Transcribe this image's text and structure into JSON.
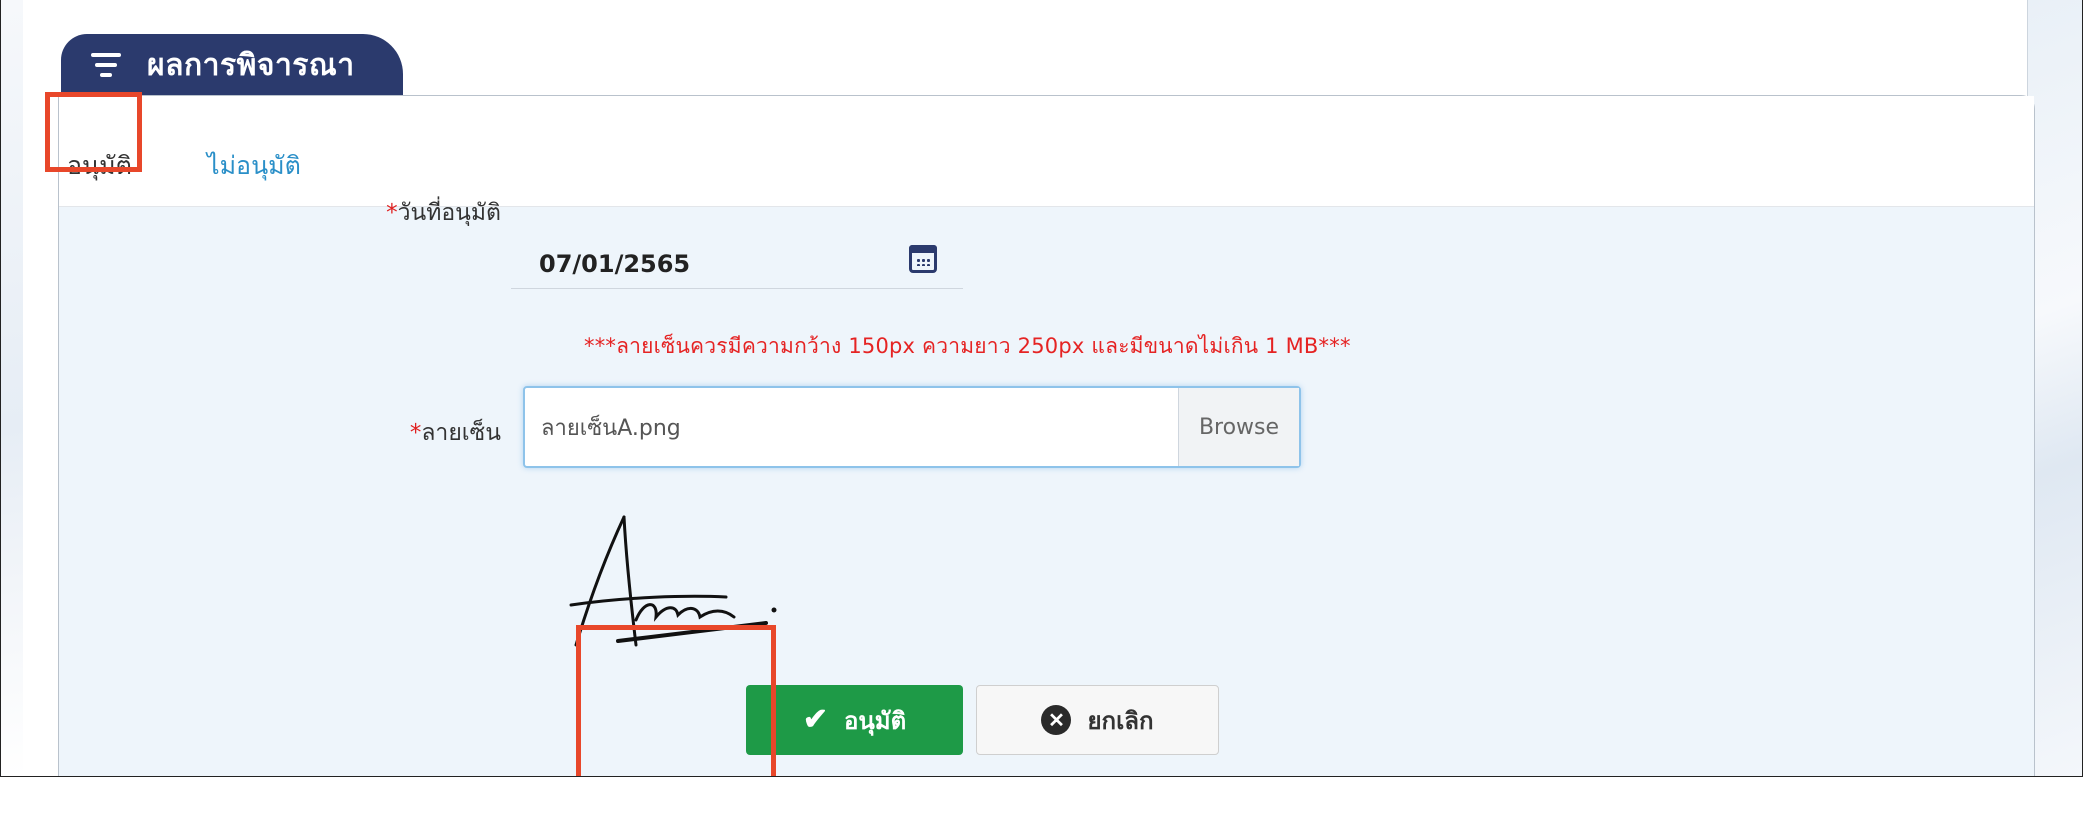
{
  "section": {
    "title": "ผลการพิจารณา",
    "icon": "filter-icon"
  },
  "tabs": [
    {
      "label": "อนุมัติ",
      "active": true
    },
    {
      "label": "ไม่อนุมัติ",
      "active": false
    }
  ],
  "form": {
    "date_label_req": "*",
    "date_label": "วันที่อนุมัติ",
    "date_value": "07/01/2565",
    "date_icon": "calendar-icon",
    "notice": "***ลายเซ็นควรมีความกว้าง 150px ความยาว 250px และมีขนาดไม่เกิน 1 MB***",
    "signature_label_req": "*",
    "signature_label": "ลายเซ็น",
    "file_value": "ลายเซ็นA.png",
    "browse_label": "Browse"
  },
  "buttons": {
    "approve_label": "อนุมัติ",
    "approve_icon": "check-icon",
    "cancel_label": "ยกเลิก",
    "cancel_icon": "times-circle-icon"
  },
  "colors": {
    "header_bg": "#2b3a6d",
    "approve_green": "#1e9a47",
    "notice_red": "#e52323",
    "highlight": "#e8472a",
    "form_bg": "#eef5fb"
  }
}
